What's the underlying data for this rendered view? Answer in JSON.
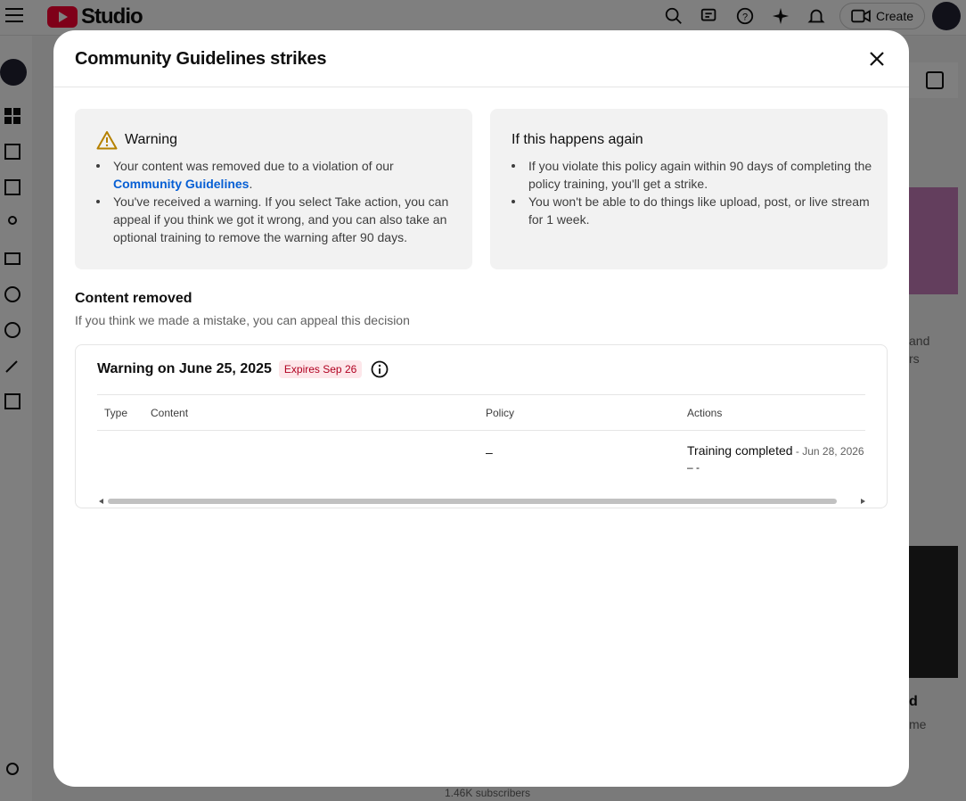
{
  "app": {
    "logo_text": "Studio",
    "create_label": "Create",
    "bg_subscribers": "1.46K subscribers",
    "bg_text_1": "and",
    "bg_text_2": "rs",
    "bg_text_3": "d",
    "bg_text_4": "me"
  },
  "dialog": {
    "title": "Community Guidelines strikes",
    "warning_card": {
      "heading": "Warning",
      "item1_text": "Your content was removed due to a violation of our",
      "item1_link": "Community Guidelines",
      "item1_suffix": ".",
      "item2_text": "You've received a warning. If you select Take action, you can appeal if you think we got it wrong, and you can also take an optional training to remove the warning after 90 days."
    },
    "again_card": {
      "heading": "If this happens again",
      "item1_text": "If you violate this policy again within 90 days of completing the policy training, you'll get a strike.",
      "item2_text": "You won't be able to do things like upload, post, or live stream for 1 week."
    },
    "section": {
      "title": "Content removed",
      "subtitle": "If you think we made a mistake, you can appeal this decision"
    },
    "strike": {
      "title": "Warning on June 25, 2025",
      "badge": "Expires Sep 26",
      "columns": {
        "type": "Type",
        "content": "Content",
        "policy": "Policy",
        "actions": "Actions"
      },
      "row": {
        "type": "",
        "content": "",
        "policy": "–",
        "action_label": "Training completed",
        "action_date": " - Jun 28, 2026",
        "action_sub": "– -"
      }
    }
  },
  "colors": {
    "accent_link": "#065fd4",
    "badge_bg": "#fde7ea",
    "badge_text": "#b00020",
    "warning_icon": "#b58100"
  }
}
